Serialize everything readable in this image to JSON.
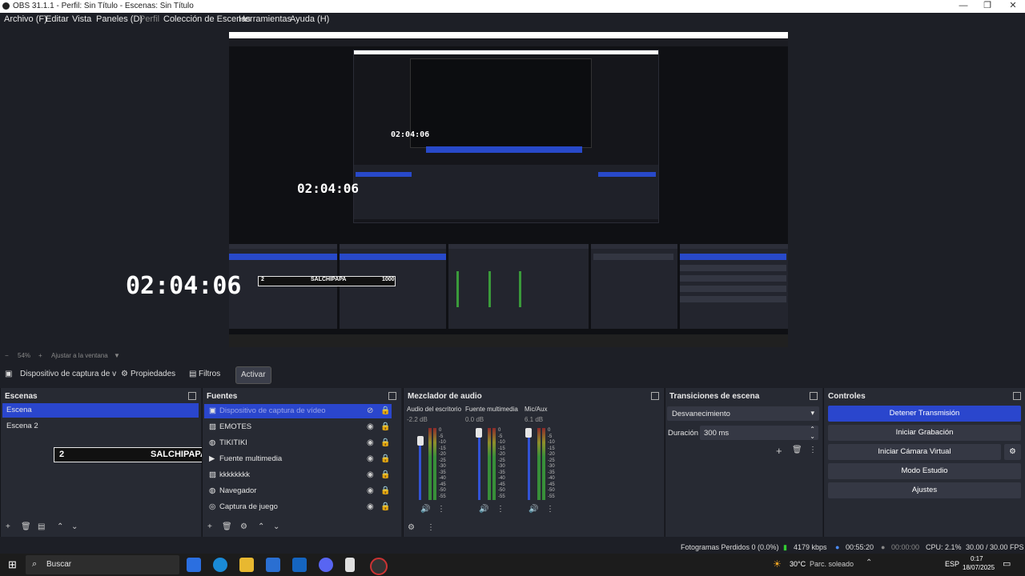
{
  "window": {
    "title": "OBS 31.1.1 - Perfil: Sin Título - Escenas: Sin Título"
  },
  "menu": [
    "Archivo (F)",
    "Editar",
    "Vista",
    "Paneles (D)",
    "Perfil",
    "Colección de Escenas",
    "Herramientas",
    "Ayuda (H)"
  ],
  "preview": {
    "clock_big": "02:04:06",
    "clock_mid": "02:04:06",
    "clock_small": "02:04:06"
  },
  "overlay": {
    "num": "2",
    "name": "SALCHIPAPA",
    "value": "1000"
  },
  "zoom": {
    "minus": "−",
    "level": "54%",
    "plus": "+",
    "fit": "Ajustar a la ventana"
  },
  "source_bar": {
    "device": "Dispositivo de captura de v",
    "properties": "Propiedades",
    "filters": "Filtros",
    "activate": "Activar"
  },
  "scenes": {
    "title": "Escenas",
    "items": [
      "Escena",
      "Escena 2"
    ]
  },
  "sources": {
    "title": "Fuentes",
    "items": [
      "Dispositivo de captura de vídeo",
      "EMOTES",
      "TIKITIKI",
      "Fuente multimedia",
      "kkkkkkkk",
      "Navegador",
      "Captura de juego"
    ]
  },
  "mixer": {
    "title": "Mezclador de audio",
    "channels": [
      {
        "name": "Audio del escritorio",
        "level": "-2.2 dB"
      },
      {
        "name": "Fuente multimedia",
        "level": "0.0 dB"
      },
      {
        "name": "Mic/Aux",
        "level": "6.1 dB"
      }
    ],
    "scale": [
      "0",
      "-5",
      "-10",
      "-15",
      "-20",
      "-25",
      "-30",
      "-35",
      "-40",
      "-45",
      "-50",
      "-55",
      "-60"
    ]
  },
  "transitions": {
    "title": "Transiciones de escena",
    "selected": "Desvanecimiento",
    "duration_label": "Duración",
    "duration_value": "300 ms"
  },
  "controls": {
    "title": "Controles",
    "buttons": [
      "Detener Transmisión",
      "Iniciar Grabación",
      "Iniciar Cámara Virtual",
      "Modo Estudio",
      "Ajustes"
    ]
  },
  "status": {
    "dropped": "Fotogramas Perdidos 0 (0.0%)",
    "bitrate": "4179 kbps",
    "stream_time": "00:55:20",
    "rec_time": "00:00:00",
    "cpu": "CPU: 2.1%",
    "fps": "30.00 / 30.00 FPS"
  },
  "taskbar": {
    "search": "Buscar",
    "weather_temp": "30°C",
    "weather_desc": "Parc. soleado",
    "lang": "ESP",
    "time": "0:17",
    "date": "18/07/2025"
  },
  "colors": {
    "accent": "#2a46cd",
    "dock_bg": "#272a33",
    "app_bg": "#1d1f26"
  }
}
